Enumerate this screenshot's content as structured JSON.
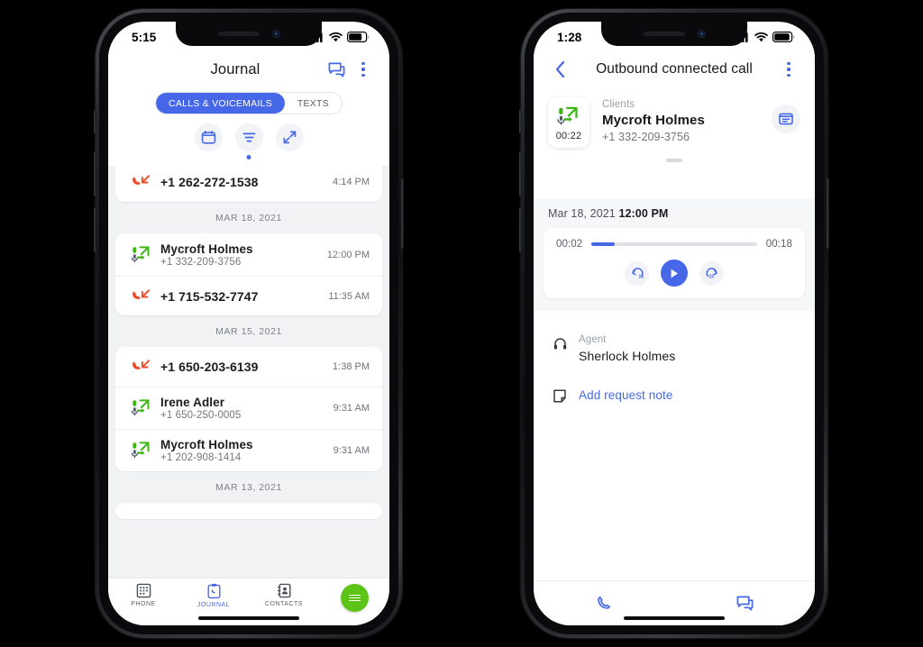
{
  "phones": {
    "left": {
      "status": {
        "time": "5:15",
        "signal": "signal-icon",
        "wifi": "wifi-icon",
        "battery": "battery-icon"
      },
      "appbar": {
        "title": "Journal",
        "message_icon": "message-icon",
        "menu_icon": "more-vertical-icon"
      },
      "tabs": [
        {
          "label": "CALLS & VOICEMAILS",
          "active": true
        },
        {
          "label": "TEXTS",
          "active": false
        }
      ],
      "filters": [
        {
          "name": "calendar-filter",
          "icon": "calendar-icon",
          "dot": false
        },
        {
          "name": "sort-filter",
          "icon": "filter-lines-icon",
          "dot": true
        },
        {
          "name": "direction-filter",
          "icon": "arrows-diagonal-icon",
          "dot": false
        }
      ],
      "journal": [
        {
          "type": "card",
          "rows": [
            {
              "icon": "missed-call-icon",
              "name": "+1 262-272-1538",
              "sub": "",
              "time": "4:14 PM"
            }
          ]
        },
        {
          "type": "separator",
          "label": "MAR 18, 2021"
        },
        {
          "type": "card",
          "rows": [
            {
              "icon": "outbound-voicemail-icon",
              "name": "Mycroft Holmes",
              "sub": "+1 332-209-3756",
              "time": "12:00 PM"
            },
            {
              "icon": "missed-call-icon",
              "name": "+1 715-532-7747",
              "sub": "",
              "time": "11:35 AM"
            }
          ]
        },
        {
          "type": "separator",
          "label": "MAR 15, 2021"
        },
        {
          "type": "card",
          "rows": [
            {
              "icon": "missed-call-icon",
              "name": "+1 650-203-6139",
              "sub": "",
              "time": "1:38 PM"
            },
            {
              "icon": "outbound-voicemail-icon",
              "name": "Irene Adler",
              "sub": "+1 650-250-0005",
              "time": "9:31 AM"
            },
            {
              "icon": "outbound-voicemail-icon",
              "name": "Mycroft Holmes",
              "sub": "+1 202-908-1414",
              "time": "9:31 AM"
            }
          ]
        },
        {
          "type": "separator",
          "label": "MAR 13, 2021"
        }
      ],
      "bottomnav": [
        {
          "label": "PHONE",
          "icon": "dialpad-icon",
          "active": false
        },
        {
          "label": "JOURNAL",
          "icon": "clipboard-phone-icon",
          "active": true
        },
        {
          "label": "CONTACTS",
          "icon": "contacts-book-icon",
          "active": false
        }
      ],
      "fab": {
        "name": "menu-fab",
        "icon": "hamburger-icon"
      }
    },
    "right": {
      "status": {
        "time": "1:28",
        "signal": "signal-icon",
        "wifi": "wifi-icon",
        "battery": "battery-icon"
      },
      "appbar": {
        "back_icon": "chevron-left-icon",
        "title": "Outbound connected call",
        "menu_icon": "more-vertical-icon"
      },
      "detail": {
        "thumb_icon": "outbound-voicemail-icon",
        "duration": "00:22",
        "group_label": "Clients",
        "contact_name": "Mycroft Holmes",
        "contact_number": "+1 332-209-3756",
        "action_icon": "note-card-icon"
      },
      "player": {
        "date": "Mar 18, 2021",
        "time": "12:00 PM",
        "elapsed": "00:02",
        "total": "00:18",
        "progress_percent": 14,
        "rewind_icon": "replay-15-icon",
        "play_icon": "play-icon",
        "forward_icon": "forward-15-icon"
      },
      "agent": {
        "icon": "headset-icon",
        "label": "Agent",
        "name": "Sherlock Holmes"
      },
      "note": {
        "icon": "note-icon",
        "label": "Add request note"
      },
      "bottombar": [
        {
          "name": "call-button",
          "icon": "phone-icon"
        },
        {
          "name": "message-button",
          "icon": "message-icon"
        }
      ]
    }
  },
  "colors": {
    "accent_blue": "#4668e8",
    "green": "#5ec318",
    "icon_green": "#3cb512",
    "missed_red": "#f04a29",
    "list_bg": "#f1f2f4"
  }
}
